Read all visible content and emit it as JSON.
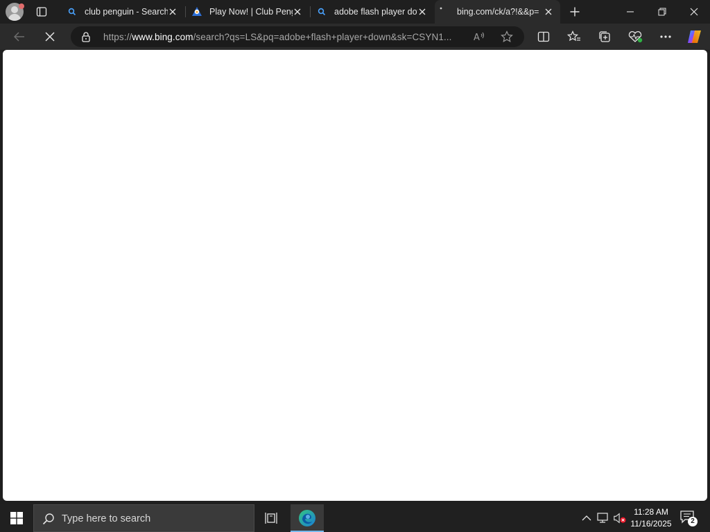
{
  "tabs": [
    {
      "title": "club penguin - Search",
      "favicon": "bing-search-icon",
      "active": false
    },
    {
      "title": "Play Now! | Club Peng",
      "favicon": "club-penguin-icon",
      "active": false
    },
    {
      "title": "adobe flash player dov",
      "favicon": "bing-search-icon",
      "active": false
    },
    {
      "title": "bing.com/ck/a?!&&p=",
      "favicon": "loading-icon",
      "active": true
    }
  ],
  "address_bar": {
    "prefix": "https://",
    "host": "www.bing.com",
    "path": "/search?qs=LS&pq=adobe+flash+player+down&sk=CSYN1..."
  },
  "taskbar": {
    "search_placeholder": "Type here to search",
    "time": "11:28 AM",
    "date": "11/16/2025",
    "notification_count": "2"
  },
  "colors": {
    "accent": "#76b9ed",
    "browser_frame": "#1f1f1f",
    "toolbar": "#2b2b2b",
    "taskbar": "#202020"
  }
}
